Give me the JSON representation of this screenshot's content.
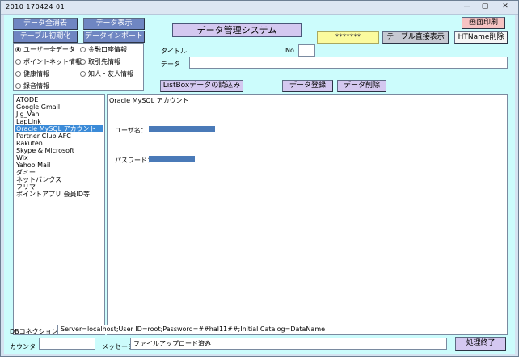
{
  "window": {
    "title": "2010 170424 01",
    "controls": {
      "minimize": "—",
      "maximize": "▢",
      "close": "✕"
    }
  },
  "toolbar": {
    "clear_all": "データ全消去",
    "show_data": "データ表示",
    "init_table": "テーブル初期化",
    "import_data": "データインポート",
    "print_screen": "画面印刷",
    "direct_table_view": "テーブル直接表示",
    "delete_name": "HTName削除",
    "yellow_box": "*******"
  },
  "app_title": "データ管理システム",
  "radio_options": [
    {
      "label": "ユーザー全データ",
      "checked": true
    },
    {
      "label": "金融口座情報",
      "checked": false
    },
    {
      "label": "ポイントネット情報",
      "checked": false
    },
    {
      "label": "取引先情報",
      "checked": false
    },
    {
      "label": "健康情報",
      "checked": false
    },
    {
      "label": "知人・友人情報",
      "checked": false
    },
    {
      "label": "録音情報",
      "checked": false
    }
  ],
  "form": {
    "title_label": "タイトル",
    "no_label": "No",
    "no_value": "",
    "data_label": "データ",
    "title_value": "",
    "data_value": ""
  },
  "actions": {
    "load_listbox": "ListBoxデータの読込み",
    "register": "データ登録",
    "delete": "データ削除",
    "finish": "処理終了"
  },
  "list_items": [
    {
      "label": "ATODE",
      "selected": false
    },
    {
      "label": "Google Gmail",
      "selected": false
    },
    {
      "label": "Jig_Van",
      "selected": false
    },
    {
      "label": "LapLink",
      "selected": false
    },
    {
      "label": "Oracle MySQL アカウント",
      "selected": true
    },
    {
      "label": "Partner Club AFC",
      "selected": false
    },
    {
      "label": "Rakuten",
      "selected": false
    },
    {
      "label": "Skype & Microsoft",
      "selected": false
    },
    {
      "label": "Wix",
      "selected": false
    },
    {
      "label": "Yahoo Mail",
      "selected": false
    },
    {
      "label": "ダミー",
      "selected": false
    },
    {
      "label": "ネットバンクス",
      "selected": false
    },
    {
      "label": "フリマ",
      "selected": false
    },
    {
      "label": "ポイントアプリ 会員ID等",
      "selected": false
    }
  ],
  "detail": {
    "heading": "Oracle MySQL アカウント",
    "user_label": "ユーザ名：",
    "password_label": "パスワード："
  },
  "status": {
    "db_label": "DBコネクション",
    "db_value": "Server=localhost;User ID=root;Password=##hal11##;Initial Catalog=DataName",
    "counter_label": "カウンタ",
    "counter_value": "",
    "message_label": "メッセージ",
    "message_value": "ファイルアップロード済み"
  }
}
